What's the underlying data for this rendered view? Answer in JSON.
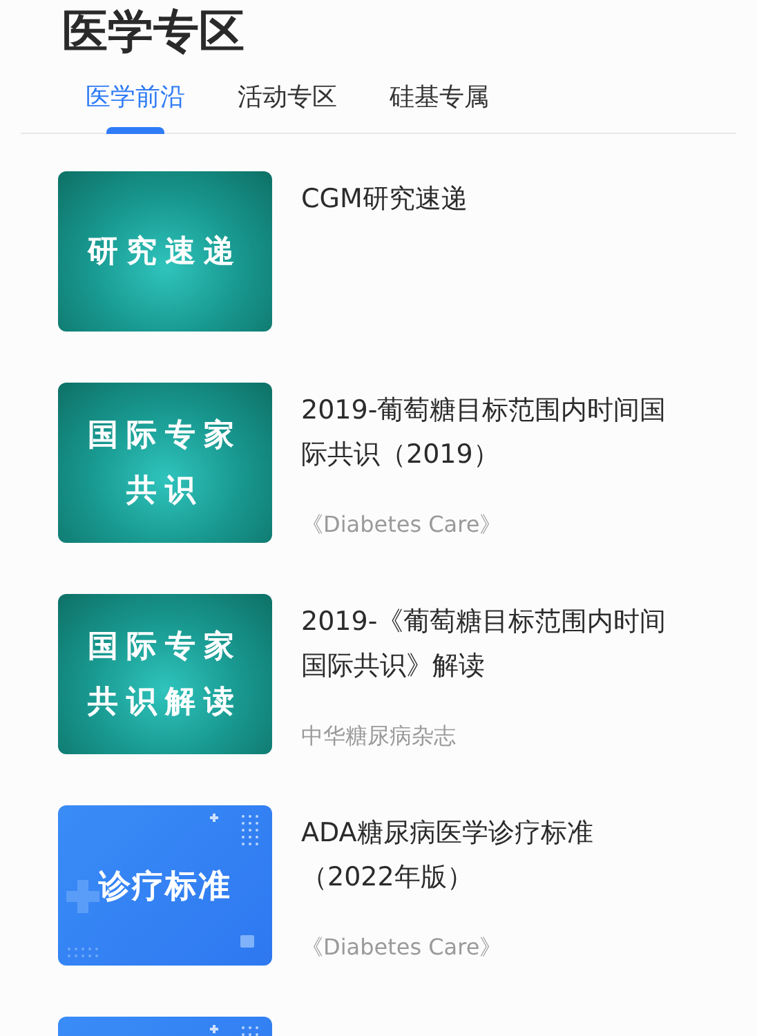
{
  "header": {
    "title": "医学专区"
  },
  "tabs": [
    {
      "label": "医学前沿",
      "selected": true
    },
    {
      "label": "活动专区",
      "selected": false
    },
    {
      "label": "硅基专属",
      "selected": false
    }
  ],
  "articles": [
    {
      "thumb": {
        "kind": "teal",
        "lines": [
          "研究速递"
        ]
      },
      "title": "CGM研究速递"
    },
    {
      "thumb": {
        "kind": "teal",
        "lines": [
          "国际专家",
          "共识"
        ]
      },
      "title": "2019-葡萄糖目标范围内时间国际共识（2019）",
      "source": "《Diabetes Care》"
    },
    {
      "thumb": {
        "kind": "teal",
        "lines": [
          "国际专家",
          "共识解读"
        ]
      },
      "title": "2019-《葡萄糖目标范围内时间国际共识》解读",
      "source": "中华糖尿病杂志"
    },
    {
      "thumb": {
        "kind": "blue",
        "lines": [
          "诊疗标准"
        ]
      },
      "title": "ADA糖尿病医学诊疗标准（2022年版）",
      "source": "《Diabetes Care》"
    },
    {
      "thumb": {
        "kind": "blue"
      }
    }
  ]
}
